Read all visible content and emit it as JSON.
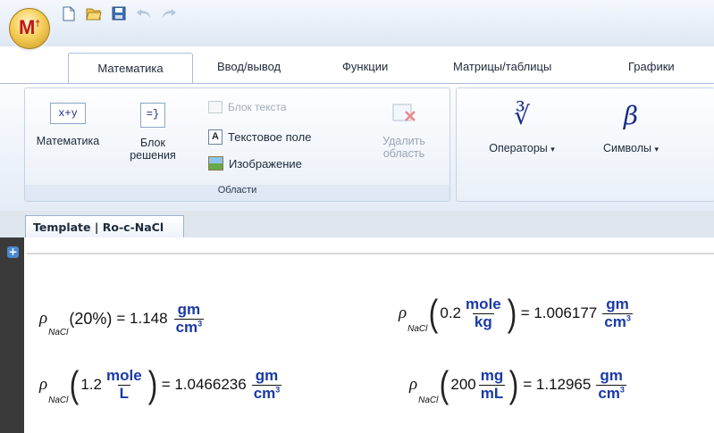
{
  "app": {
    "orb_letter": "M",
    "orb_superscript": "†"
  },
  "tabs": [
    {
      "label": "Математика",
      "active": true
    },
    {
      "label": "Ввод/вывод"
    },
    {
      "label": "Функции"
    },
    {
      "label": "Матрицы/таблицы"
    },
    {
      "label": "Графики"
    }
  ],
  "ribbon": {
    "math_button": "Математика",
    "math_icon_text": "x+y",
    "block_line1": "Блок",
    "block_line2": "решения",
    "text_block": "Блок текста",
    "text_field": "Текстовое поле",
    "image": "Изображение",
    "delete_line1": "Удалить",
    "delete_line2": "область",
    "regions_group": "Области",
    "operators": "Операторы",
    "symbols": "Символы",
    "field_icon_letter": "A",
    "beta_symbol": "β",
    "root_symbol": "∛"
  },
  "document": {
    "tab_title": "Template | Ro-c-NaCl"
  },
  "equations": {
    "rho": "ρ",
    "sub": "NaCl",
    "e1": {
      "arg": "(20%)",
      "eq": "= 1.148",
      "num": "gm",
      "den": "cm",
      "exp": "3"
    },
    "e2": {
      "val": "0.2",
      "unum": "mole",
      "uden": "kg",
      "eq": "= 1.006177",
      "num": "gm",
      "den": "cm",
      "exp": "3"
    },
    "e3": {
      "val": "1.2",
      "unum": "mole",
      "uden": "L",
      "eq": "= 1.0466236",
      "num": "gm",
      "den": "cm",
      "exp": "3"
    },
    "e4": {
      "val": "200",
      "unum": "mg",
      "uden": "mL",
      "eq": "= 1.12965",
      "num": "gm",
      "den": "cm",
      "exp": "3"
    }
  }
}
